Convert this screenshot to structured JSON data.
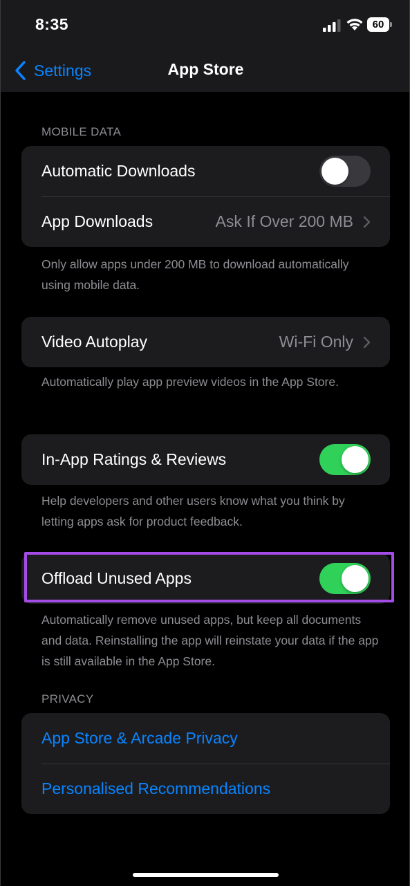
{
  "status_bar": {
    "time": "8:35",
    "battery": "60"
  },
  "nav": {
    "back_label": "Settings",
    "title": "App Store"
  },
  "mobile_data": {
    "header": "MOBILE DATA",
    "automatic_downloads": {
      "label": "Automatic Downloads",
      "on": false
    },
    "app_downloads": {
      "label": "App Downloads",
      "value": "Ask If Over 200 MB"
    },
    "footer": "Only allow apps under 200 MB to download automatically using mobile data."
  },
  "video": {
    "label": "Video Autoplay",
    "value": "Wi-Fi Only",
    "footer": "Automatically play app preview videos in the App Store."
  },
  "ratings": {
    "label": "In-App Ratings & Reviews",
    "on": true,
    "footer": "Help developers and other users know what you think by letting apps ask for product feedback."
  },
  "offload": {
    "label": "Offload Unused Apps",
    "on": true,
    "footer": "Automatically remove unused apps, but keep all documents and data. Reinstalling the app will reinstate your data if the app is still available in the App Store."
  },
  "privacy": {
    "header": "PRIVACY",
    "items": [
      {
        "label": "App Store & Arcade Privacy"
      },
      {
        "label": "Personalised Recommendations"
      }
    ]
  },
  "colors": {
    "accent": "#0a84ff",
    "toggle_on": "#30d158",
    "highlight": "#a44ce8"
  }
}
